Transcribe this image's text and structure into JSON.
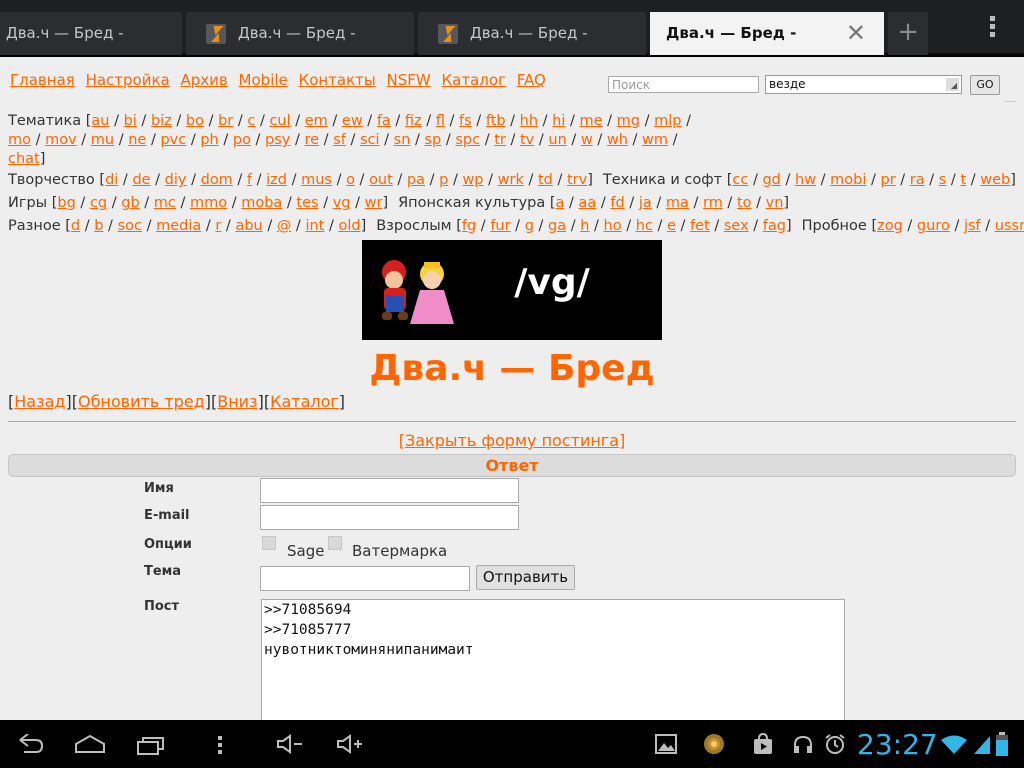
{
  "browser": {
    "tabs": [
      {
        "title": "Два.ч — Бред -",
        "has_icon": false
      },
      {
        "title": "Два.ч — Бред -",
        "has_icon": true
      },
      {
        "title": "Два.ч — Бред -",
        "has_icon": true
      },
      {
        "title": "Два.ч — Бред -",
        "has_icon": false,
        "active": true
      }
    ],
    "new_tab_glyph": "+",
    "close_glyph": "✕"
  },
  "topnav": {
    "links": [
      "Главная",
      "Настройка",
      "Архив",
      "Mobile",
      "Контакты",
      "NSFW",
      "Каталог",
      "FAQ"
    ]
  },
  "search": {
    "placeholder": "Поиск",
    "scope_value": "везде",
    "go_label": "GO"
  },
  "boards": {
    "thematic": {
      "label": "Тематика",
      "links": [
        "au",
        "bi",
        "biz",
        "bo",
        "br",
        "c",
        "cul",
        "em",
        "ew",
        "fa",
        "fiz",
        "fl",
        "fs",
        "ftb",
        "hh",
        "hi",
        "me",
        "mg",
        "mlp",
        "mo",
        "mov",
        "mu",
        "ne",
        "pvc",
        "ph",
        "po",
        "psy",
        "re",
        "sf",
        "sci",
        "sn",
        "sp",
        "spc",
        "tr",
        "tv",
        "un",
        "w",
        "wh",
        "wm",
        "chat"
      ]
    },
    "creative": {
      "label": "Творчество",
      "links": [
        "di",
        "de",
        "diy",
        "dom",
        "f",
        "izd",
        "mus",
        "o",
        "out",
        "pa",
        "p",
        "wp",
        "wrk",
        "td",
        "trv"
      ]
    },
    "tech": {
      "label": "Техника и софт",
      "links": [
        "cc",
        "gd",
        "hw",
        "mobi",
        "pr",
        "ra",
        "s",
        "t",
        "web"
      ]
    },
    "games": {
      "label": "Игры",
      "links": [
        "bg",
        "cg",
        "gb",
        "mc",
        "mmo",
        "moba",
        "tes",
        "vg",
        "wr"
      ]
    },
    "japanese": {
      "label": "Японская культура",
      "links": [
        "a",
        "aa",
        "fd",
        "ja",
        "ma",
        "rm",
        "to",
        "vn"
      ]
    },
    "misc": {
      "label": "Разное",
      "links": [
        "d",
        "b",
        "soc",
        "media",
        "r",
        "abu",
        "@",
        "int",
        "old"
      ]
    },
    "adult": {
      "label": "Взрослым",
      "links": [
        "fg",
        "fur",
        "g",
        "ga",
        "h",
        "ho",
        "hc",
        "e",
        "fet",
        "sex",
        "fag"
      ]
    },
    "trial": {
      "label": "Пробное",
      "links": [
        "zog",
        "guro",
        "jsf",
        "ussr"
      ]
    }
  },
  "banner": {
    "text": "/vg/"
  },
  "board_title": "Два.ч — Бред",
  "thread_nav": [
    "Назад",
    "Обновить тред",
    "Вниз",
    "Каталог"
  ],
  "close_form_link": "[Закрыть форму постинга]",
  "reply_header": "Ответ",
  "form": {
    "name_label": "Имя",
    "email_label": "E-mail",
    "options_label": "Опции",
    "sage_label": "Sage",
    "watermark_label": "Ватермарка",
    "subject_label": "Тема",
    "submit_label": "Отправить",
    "post_label": "Пост",
    "post_text": ">>71085694\n>>71085777\nнувотниктоминянипанимаит"
  },
  "system": {
    "clock": "23:27",
    "accent": "#33b5e5"
  }
}
